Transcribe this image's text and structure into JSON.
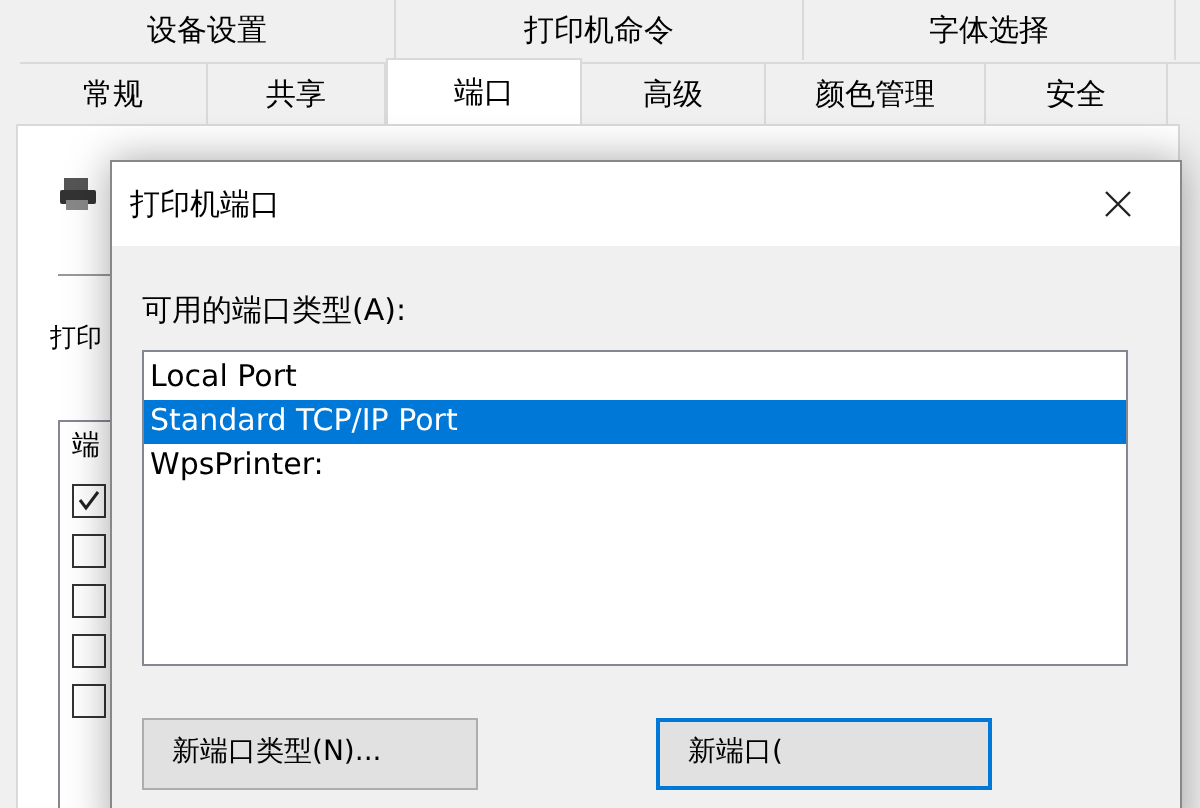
{
  "tabs_row_1": [
    {
      "label": "设备设置",
      "selected": false
    },
    {
      "label": "打印机命令",
      "selected": false
    },
    {
      "label": "字体选择",
      "selected": false
    }
  ],
  "tabs_row_2": [
    {
      "label": "常规",
      "selected": false
    },
    {
      "label": "共享",
      "selected": false
    },
    {
      "label": "端口",
      "selected": true
    },
    {
      "label": "高级",
      "selected": false
    },
    {
      "label": "颜色管理",
      "selected": false
    },
    {
      "label": "安全",
      "selected": false
    }
  ],
  "background": {
    "printer_label": "打印",
    "list_header": "端",
    "checkboxes": [
      {
        "checked": true
      },
      {
        "checked": false
      },
      {
        "checked": false
      },
      {
        "checked": false
      },
      {
        "checked": false
      }
    ]
  },
  "dialog": {
    "title": "打印机端口",
    "list_label": "可用的端口类型(A):",
    "port_types": [
      {
        "label": "Local Port",
        "selected": false
      },
      {
        "label": "Standard TCP/IP Port",
        "selected": true
      },
      {
        "label": "WpsPrinter:",
        "selected": false
      }
    ],
    "buttons": [
      {
        "label": "新端口类型(N)...",
        "default": false
      },
      {
        "label": "新端口(",
        "default": true
      }
    ]
  }
}
